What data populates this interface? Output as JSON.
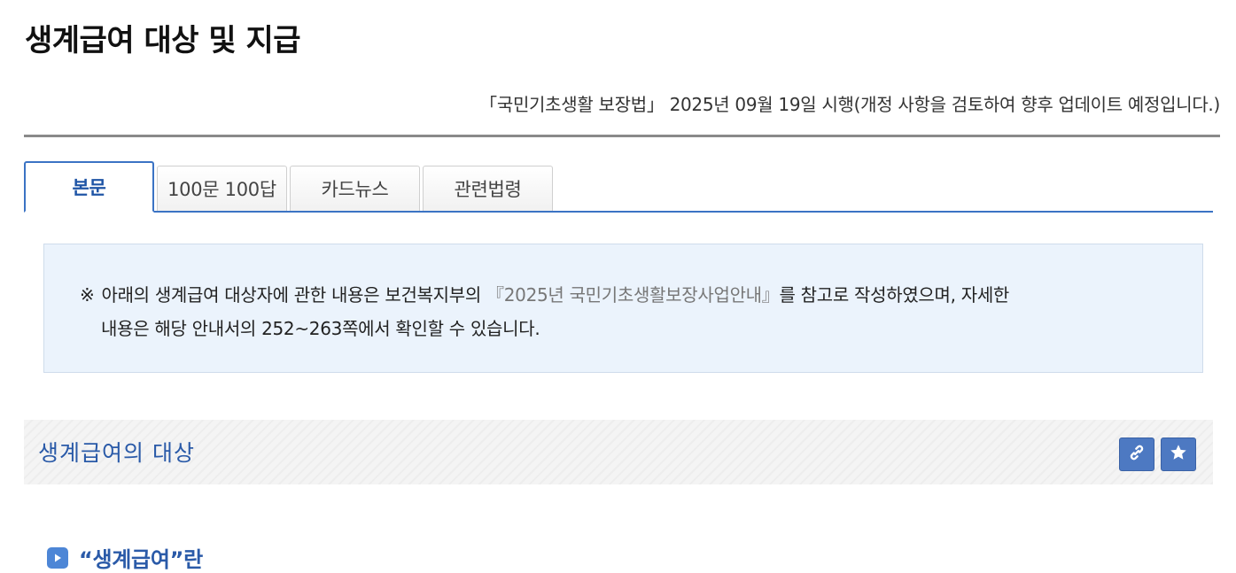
{
  "page": {
    "title": "생계급여 대상 및 지급",
    "law_note": "「국민기초생활 보장법」 2025년 09월 19일 시행(개정 사항을 검토하여 향후 업데이트 예정입니다.)"
  },
  "tabs": [
    {
      "label": "본문",
      "active": true
    },
    {
      "label": "100문 100답",
      "active": false
    },
    {
      "label": "카드뉴스",
      "active": false
    },
    {
      "label": "관련법령",
      "active": false
    }
  ],
  "notice": {
    "mark": "※",
    "text_before": "아래의 생계급여 대상자에 관한 내용은 보건복지부의",
    "book_title": "『2025년 국민기초생활보장사업안내』",
    "text_after": "를 참고로 작성하였으며, 자세한",
    "text_line2": "내용은 해당 안내서의 252~263쪽에서 확인할 수 있습니다."
  },
  "section": {
    "title": "생계급여의 대상",
    "link_icon": "link-icon",
    "favorite_icon": "star-icon"
  },
  "subheading": {
    "text": "“생계급여”란",
    "icon": "play-icon"
  },
  "colors": {
    "accent": "#3b73c4",
    "section_title": "#2a5aa8",
    "notice_bg": "#ebf3fc",
    "button_bg": "#4d79c2"
  }
}
